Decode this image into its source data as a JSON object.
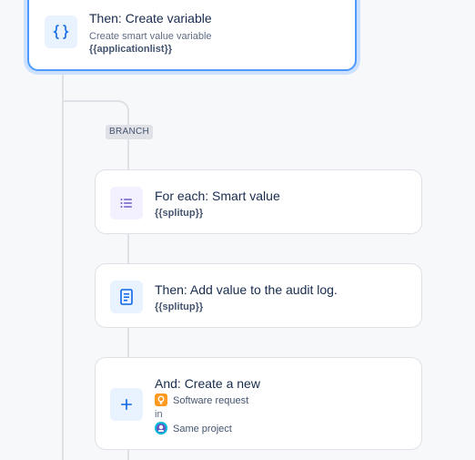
{
  "top_card": {
    "title": "Then: Create variable",
    "subtitle": "Create smart value variable",
    "value": "{{applicationlist}}",
    "icon": "curly-braces-icon"
  },
  "branch": {
    "label": "BRANCH"
  },
  "cards": [
    {
      "title": "For each: Smart value",
      "value": "{{splitup}}",
      "icon": "list-icon"
    },
    {
      "title": "Then: Add value to the audit log.",
      "value": "{{splitup}}",
      "icon": "document-icon"
    },
    {
      "title": "And: Create a new",
      "issue_type": "Software request",
      "in_label": "in",
      "project": "Same project",
      "icon": "plus-icon"
    }
  ],
  "colors": {
    "accent": "#0c66e4",
    "selected_border": "#4c9aff",
    "line": "#dfe1e6",
    "issue_type_icon": "#ff991f"
  }
}
